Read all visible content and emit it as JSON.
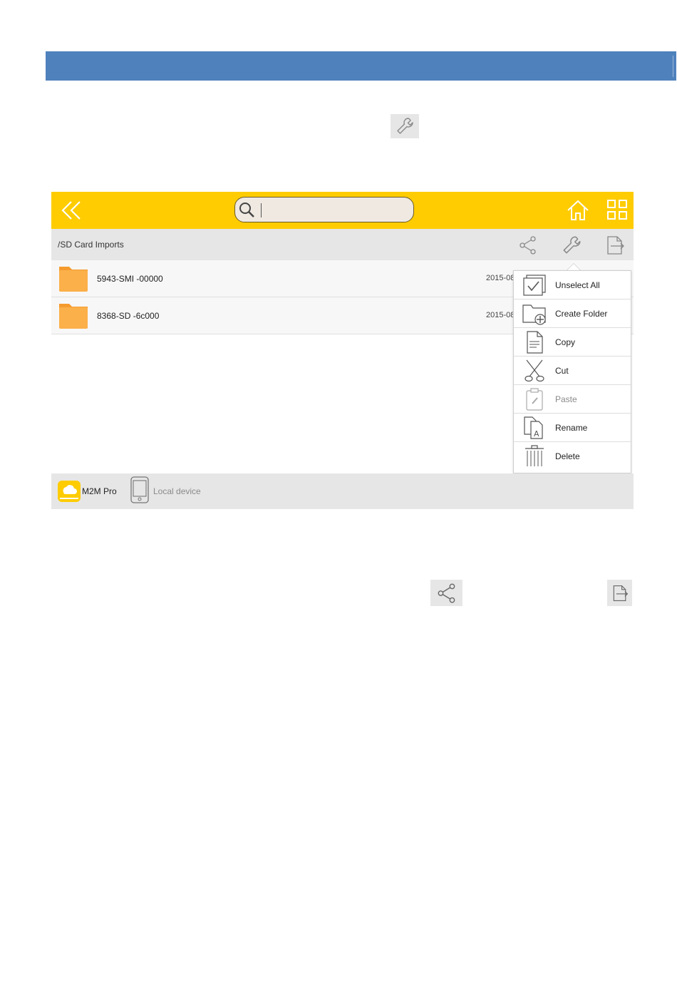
{
  "search": {
    "value": "",
    "placeholder": ""
  },
  "path": "/SD Card Imports",
  "files": [
    {
      "name": "5943-SMI  -00000",
      "date": "2015-08"
    },
    {
      "name": "8368-SD   -6c000",
      "date": "2015-08"
    }
  ],
  "menu": {
    "items": [
      {
        "label": "Unselect All",
        "icon": "checkbox-stack-icon",
        "enabled": true
      },
      {
        "label": "Create Folder",
        "icon": "folder-plus-icon",
        "enabled": true
      },
      {
        "label": "Copy",
        "icon": "document-icon",
        "enabled": true
      },
      {
        "label": "Cut",
        "icon": "scissors-icon",
        "enabled": true
      },
      {
        "label": "Paste",
        "icon": "clipboard-icon",
        "enabled": false
      },
      {
        "label": "Rename",
        "icon": "rename-icon",
        "enabled": true
      },
      {
        "label": "Delete",
        "icon": "trash-icon",
        "enabled": true
      }
    ]
  },
  "sources": [
    {
      "label": "M2M Pro",
      "icon": "cloud-drive-icon",
      "active": true
    },
    {
      "label": "Local device",
      "icon": "phone-icon",
      "active": false
    }
  ],
  "colors": {
    "header_blue": "#4f81bd",
    "topbar_yellow": "#fecc00",
    "folder_orange": "#fbb04a",
    "panel_gray": "#e6e6e6"
  }
}
